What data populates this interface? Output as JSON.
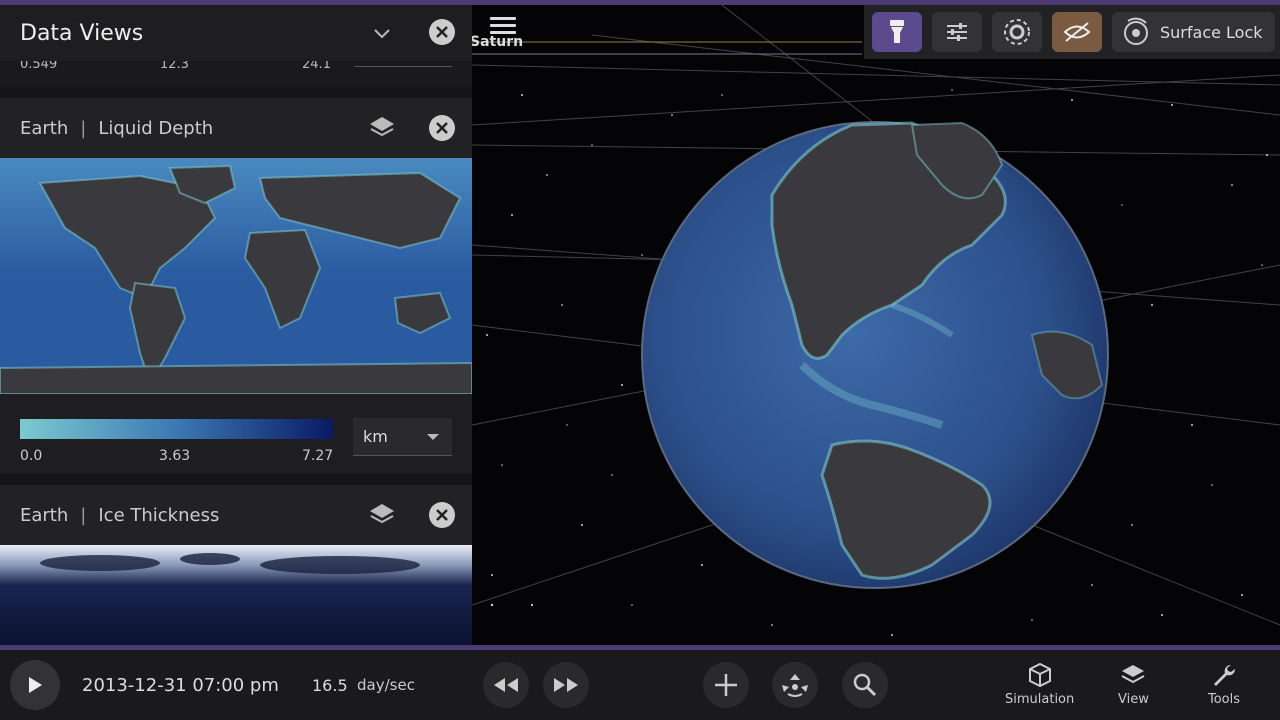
{
  "panel": {
    "title": "Data Views",
    "strip_values": [
      "0.549",
      "12.3",
      "24.1"
    ]
  },
  "cards": [
    {
      "body": "Earth",
      "layer": "Liquid Depth"
    },
    {
      "body": "Earth",
      "layer": "Ice Thickness"
    }
  ],
  "legend": {
    "min": "0.0",
    "mid": "3.63",
    "max": "7.27",
    "unit": "km",
    "gradient": [
      "#7ccad0",
      "#3c78b4",
      "#0a1a66"
    ]
  },
  "viewport": {
    "target_label": "Saturn"
  },
  "toolbar": {
    "surface_lock_label": "Surface Lock",
    "icons": [
      "flashlight-icon",
      "sliders-icon",
      "orbit-icon",
      "visibility-off-icon",
      "surface-lock-icon"
    ]
  },
  "timebar": {
    "datetime": "2013-12-31 07:00 pm",
    "rate": "16.5",
    "rate_unit": "day/sec"
  },
  "nav": {
    "simulation": "Simulation",
    "view": "View",
    "tools": "Tools"
  },
  "colors": {
    "accent": "#4b3a73",
    "active_purple": "#5b4a8c",
    "active_brown": "#7a5a40",
    "ocean": "#2d5a9e",
    "land": "#3a3a3e"
  }
}
